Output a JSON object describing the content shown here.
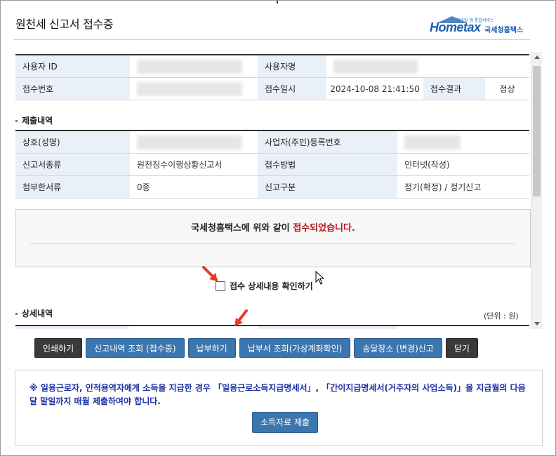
{
  "window": {
    "title": "원천세 신고서 접수증"
  },
  "logo": {
    "small": "모바일 앱 통합서비스",
    "brand": "Hometax",
    "name": "국세청홈택스"
  },
  "receipt": {
    "rows": [
      {
        "label1": "사용자 ID",
        "value1": "",
        "label2": "사용자명",
        "value2": ""
      },
      {
        "label1": "접수번호",
        "value1": "",
        "label2": "접수일시",
        "value2": "2024-10-08 21:41:50",
        "label3": "접수결과",
        "value3": "정상"
      }
    ]
  },
  "submission": {
    "section_title": "제출내역",
    "rows": [
      {
        "label1": "상호(성명)",
        "value1": "",
        "label2": "사업자(주민)등록번호",
        "value2": ""
      },
      {
        "label1": "신고서종류",
        "value1": "원천징수이행상황신고서",
        "label2": "접수방법",
        "value2": "인터넷(작성)"
      },
      {
        "label1": "첨부한서류",
        "value1": "0종",
        "label2": "신고구분",
        "value2": "정기(확정) / 정기신고"
      }
    ]
  },
  "notice": {
    "prefix": "국세청홈택스에 위와 같이 ",
    "highlight": "접수되었습니다."
  },
  "confirm": {
    "label": "접수 상세내용 확인하기"
  },
  "details": {
    "section_title": "상세내역",
    "unit": "(단위 : 원)"
  },
  "buttons": {
    "print": "인쇄하기",
    "history": "신고내역 조회 (접수증)",
    "pay": "납부하기",
    "bill": "납부서 조회(가상계좌확인)",
    "address": "송달장소 (변경)신고",
    "close": "닫기"
  },
  "bottom": {
    "text": "※ 일용근로자, 인적용역자에게 소득을 지급한 경우 「일용근로소득지급명세서」, 「간이지급명세서(거주자의 사업소득)」을 지급월의 다음달 말일까지 매월 제출하여야 합니다.",
    "button": "소득자료 제출"
  },
  "colors": {
    "accent": "#3c76ae",
    "highlight": "#b3141c",
    "annotation_arrow": "#e53b2c",
    "notice_text": "#1a2fa0"
  }
}
